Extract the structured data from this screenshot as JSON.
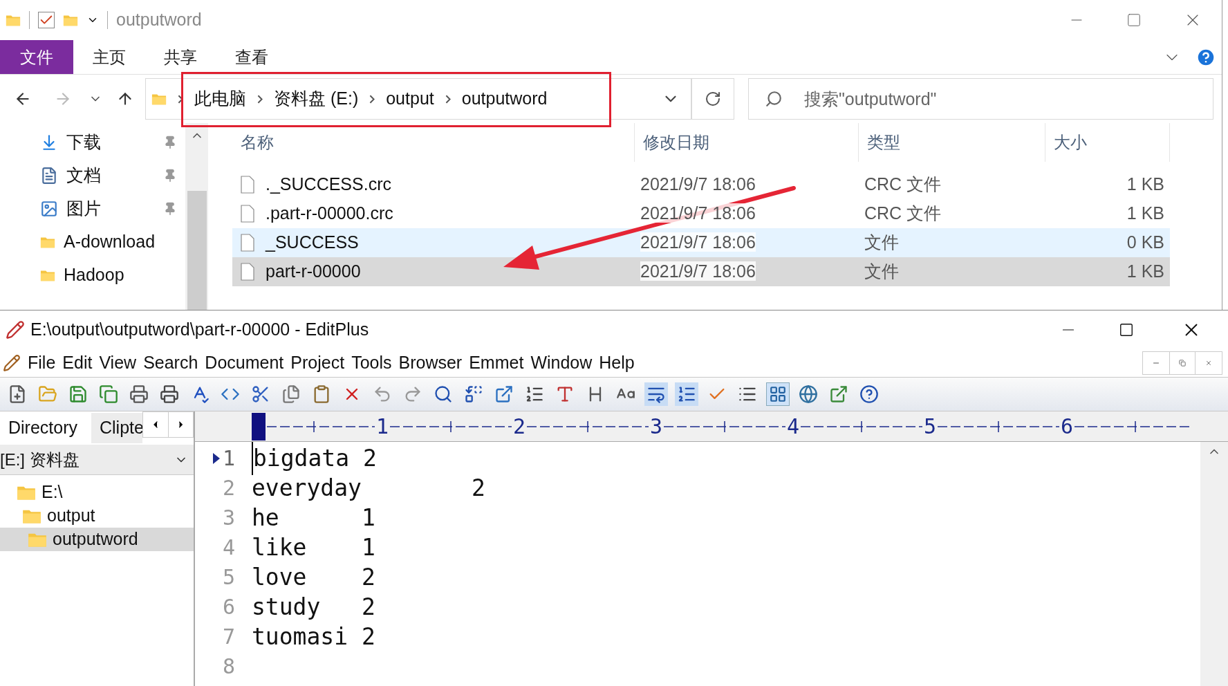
{
  "explorer": {
    "title": "outputword",
    "ribbon_tabs": [
      {
        "label": "文件",
        "selected": true
      },
      {
        "label": "主页",
        "selected": false
      },
      {
        "label": "共享",
        "selected": false
      },
      {
        "label": "查看",
        "selected": false
      }
    ],
    "breadcrumb": [
      "此电脑",
      "资料盘 (E:)",
      "output",
      "outputword"
    ],
    "search": {
      "placeholder": "搜索\"outputword\""
    },
    "nav": [
      {
        "label": "下载",
        "kind": "download",
        "pinned": true
      },
      {
        "label": "文档",
        "kind": "documents",
        "pinned": true
      },
      {
        "label": "图片",
        "kind": "pictures",
        "pinned": true
      },
      {
        "label": "A-download",
        "kind": "folder",
        "pinned": false
      },
      {
        "label": "Hadoop",
        "kind": "folder",
        "pinned": false
      }
    ],
    "columns": [
      "名称",
      "修改日期",
      "类型",
      "大小"
    ],
    "files": [
      {
        "name": "._SUCCESS.crc",
        "modified": "2021/9/7 18:06",
        "type": "CRC 文件",
        "size": "1 KB",
        "hovered": false,
        "selected": false
      },
      {
        "name": ".part-r-00000.crc",
        "modified": "2021/9/7 18:06",
        "type": "CRC 文件",
        "size": "1 KB",
        "hovered": false,
        "selected": false
      },
      {
        "name": "_SUCCESS",
        "modified": "2021/9/7 18:06",
        "type": "文件",
        "size": "0 KB",
        "hovered": true,
        "selected": false
      },
      {
        "name": "part-r-00000",
        "modified": "2021/9/7 18:06",
        "type": "文件",
        "size": "1 KB",
        "hovered": false,
        "selected": true
      }
    ]
  },
  "editplus": {
    "title": "E:\\output\\outputword\\part-r-00000 - EditPlus",
    "menu": [
      "File",
      "Edit",
      "View",
      "Search",
      "Document",
      "Project",
      "Tools",
      "Browser",
      "Emmet",
      "Window",
      "Help"
    ],
    "panel_tabs": [
      {
        "label": "Directory",
        "selected": true
      },
      {
        "label": "Clipte",
        "selected": false
      }
    ],
    "drive": "[E:] 资料盘",
    "tree": [
      {
        "label": "E:\\",
        "selected": false,
        "children": [
          {
            "label": "output",
            "selected": false,
            "children": [
              {
                "label": "outputword",
                "selected": true
              }
            ]
          }
        ]
      }
    ],
    "ruler": [
      "1",
      "2",
      "3",
      "4",
      "5",
      "6"
    ],
    "lines": [
      {
        "number": "1",
        "text": "bigdata 2",
        "current": true
      },
      {
        "number": "2",
        "text": "everyday        2",
        "current": false
      },
      {
        "number": "3",
        "text": "he      1",
        "current": false
      },
      {
        "number": "4",
        "text": "like    1",
        "current": false
      },
      {
        "number": "5",
        "text": "love    2",
        "current": false
      },
      {
        "number": "6",
        "text": "study   2",
        "current": false
      },
      {
        "number": "7",
        "text": "tuomasi 2",
        "current": false
      },
      {
        "number": "8",
        "current": false
      }
    ]
  }
}
